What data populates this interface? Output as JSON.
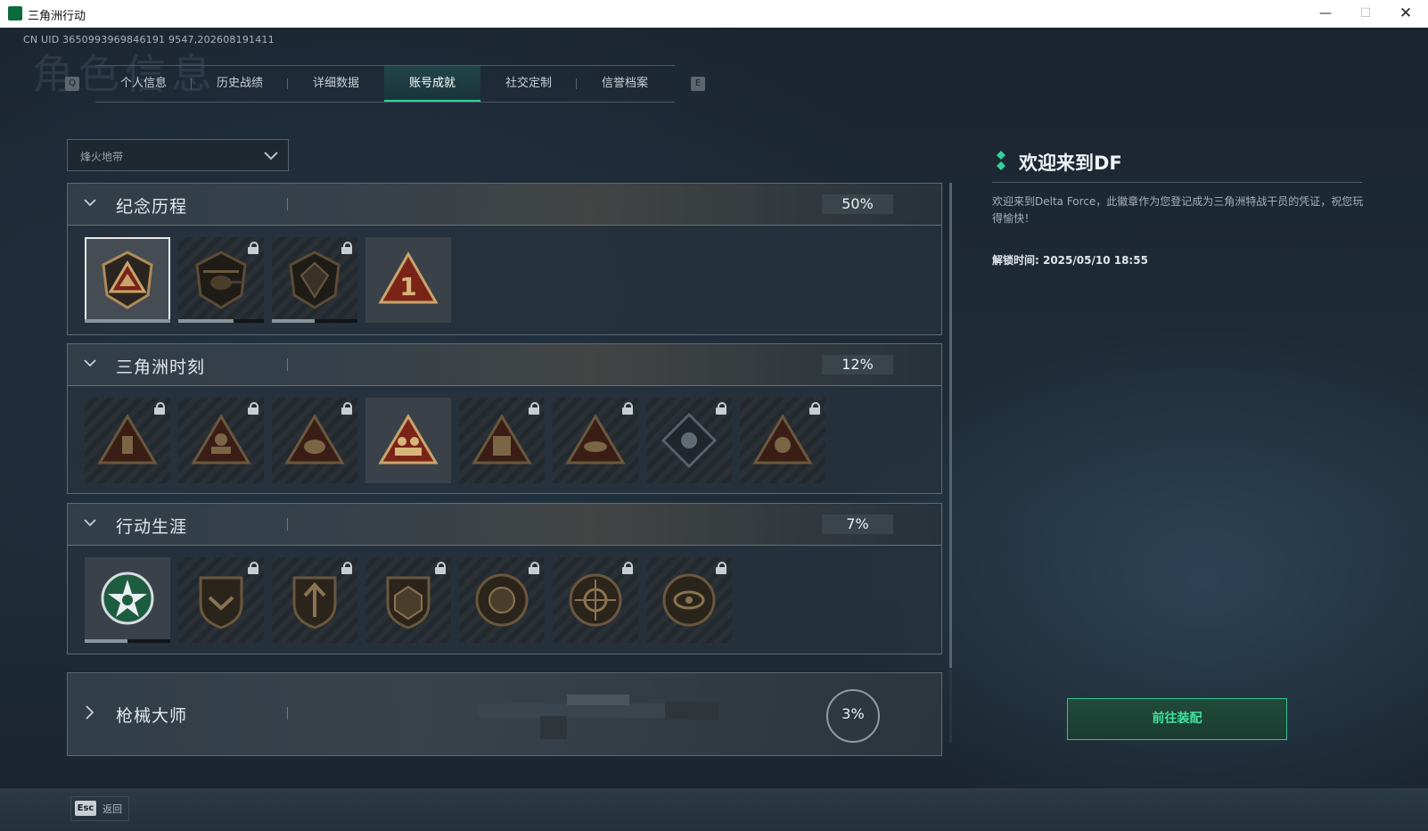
{
  "window": {
    "title": "三角洲行动",
    "min": "—",
    "max": "☐",
    "close": "✕"
  },
  "uid": "CN UID 3650993969846191 9547,202608191411",
  "background_title": "角色信息",
  "tabs": {
    "left_key": "Q",
    "right_key": "E",
    "items": [
      {
        "label": "个人信息"
      },
      {
        "label": "历史战绩"
      },
      {
        "label": "详细数据"
      },
      {
        "label": "账号成就"
      },
      {
        "label": "社交定制"
      },
      {
        "label": "信誉档案"
      }
    ],
    "active_index": 3
  },
  "mode_select": {
    "value": "烽火地带"
  },
  "categories": [
    {
      "title": "纪念历程",
      "percent": "50%",
      "expanded": true,
      "badges": [
        {
          "icon": "delta-shield-badge-icon",
          "locked": false,
          "selected": true,
          "progress": 1
        },
        {
          "icon": "helicopter-badge-icon",
          "locked": true,
          "progress": 0.65
        },
        {
          "icon": "emblem-shield-badge-icon",
          "locked": true,
          "progress": 0.5
        },
        {
          "icon": "rank-one-triangle-badge-icon",
          "locked": false,
          "progress": 1
        }
      ]
    },
    {
      "title": "三角洲时刻",
      "percent": "12%",
      "expanded": true,
      "badges": [
        {
          "icon": "soldier-triangle-badge-icon",
          "locked": true
        },
        {
          "icon": "runner-triangle-badge-icon",
          "locked": true
        },
        {
          "icon": "helmet-triangle-badge-icon",
          "locked": true
        },
        {
          "icon": "squad-triangle-badge-icon",
          "locked": false
        },
        {
          "icon": "rally-triangle-badge-icon",
          "locked": true
        },
        {
          "icon": "fish-triangle-badge-icon",
          "locked": true
        },
        {
          "icon": "diamond-badge-icon",
          "locked": true
        },
        {
          "icon": "beast-triangle-badge-icon",
          "locked": true
        }
      ]
    },
    {
      "title": "行动生涯",
      "percent": "7%",
      "expanded": true,
      "badges": [
        {
          "icon": "star-wreath-badge-icon",
          "locked": false,
          "progress": 0.5
        },
        {
          "icon": "chevron-shield-badge-icon",
          "locked": true
        },
        {
          "icon": "arrow-shield-badge-icon",
          "locked": true
        },
        {
          "icon": "dice-shield-badge-icon",
          "locked": true
        },
        {
          "icon": "seal-badge-icon",
          "locked": true
        },
        {
          "icon": "crosshair-badge-icon",
          "locked": true
        },
        {
          "icon": "eye-badge-icon",
          "locked": true
        }
      ]
    }
  ],
  "gun_master": {
    "title": "枪械大师",
    "percent": "3%",
    "expanded": false
  },
  "detail": {
    "title": "欢迎来到DF",
    "description": "欢迎来到Delta Force，此徽章作为您登记成为三角洲特战干员的凭证，祝您玩得愉快！",
    "unlock_time": "解锁时间: 2025/05/10 18:55"
  },
  "equip_button": "前往装配",
  "footer": {
    "esc_key": "Esc",
    "esc_label": "返回"
  },
  "colors": {
    "accent": "#2fd49a",
    "badge_gold": "#b08a57",
    "badge_red": "#7a2418"
  }
}
